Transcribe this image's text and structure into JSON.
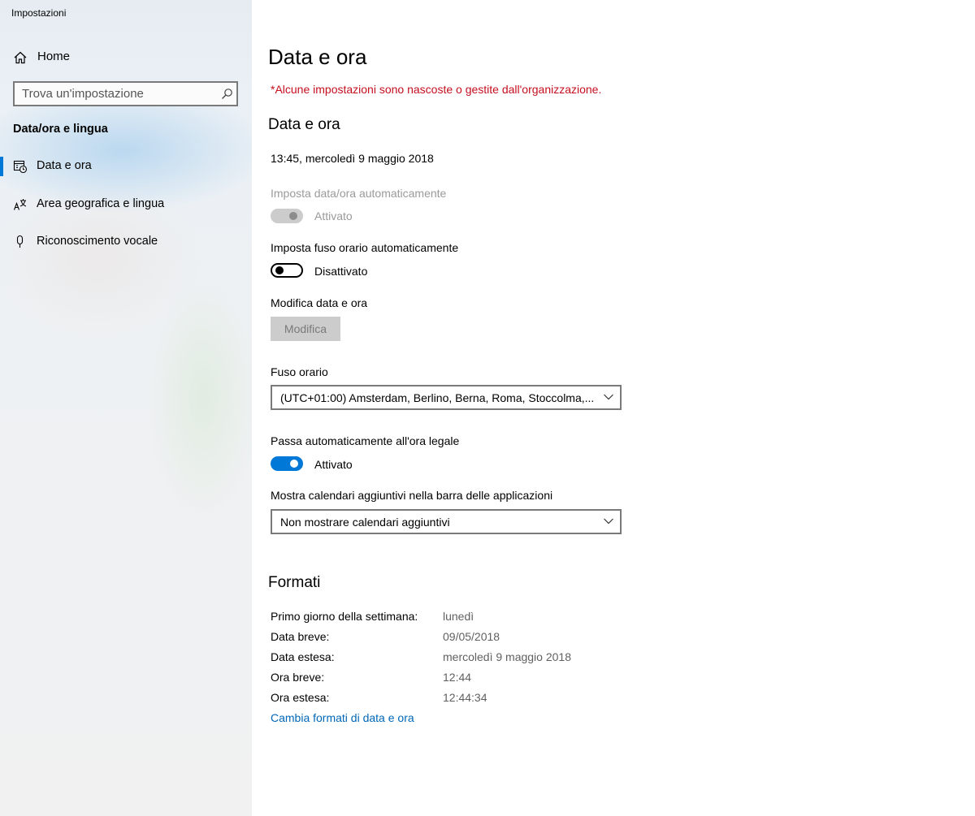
{
  "window": {
    "title": "Impostazioni"
  },
  "sidebar": {
    "home_label": "Home",
    "search_placeholder": "Trova un'impostazione",
    "section_header": "Data/ora e lingua",
    "items": [
      {
        "label": "Data e ora",
        "icon": "calendar-clock-icon",
        "selected": true
      },
      {
        "label": "Area geografica e lingua",
        "icon": "language-icon",
        "selected": false
      },
      {
        "label": "Riconoscimento vocale",
        "icon": "microphone-icon",
        "selected": false
      }
    ]
  },
  "main": {
    "title": "Data e ora",
    "warning": "*Alcune impostazioni sono nascoste o gestite dall'organizzazione.",
    "section_datetime": {
      "heading": "Data e ora",
      "current": "13:45, mercoledì 9 maggio 2018",
      "auto_time": {
        "label": "Imposta data/ora automaticamente",
        "state": "Attivato",
        "enabled": false,
        "on": true
      },
      "auto_timezone": {
        "label": "Imposta fuso orario automaticamente",
        "state": "Disattivato",
        "on": false
      },
      "change": {
        "label": "Modifica data e ora",
        "button": "Modifica"
      },
      "timezone": {
        "label": "Fuso orario",
        "value": "(UTC+01:00) Amsterdam, Berlino, Berna, Roma, Stoccolma,..."
      },
      "dst": {
        "label": "Passa automaticamente all'ora legale",
        "state": "Attivato",
        "on": true
      },
      "calendars": {
        "label": "Mostra calendari aggiuntivi nella barra delle applicazioni",
        "value": "Non mostrare calendari aggiuntivi"
      }
    },
    "formats": {
      "heading": "Formati",
      "rows": [
        {
          "label": "Primo giorno della settimana:",
          "value": "lunedì"
        },
        {
          "label": "Data breve:",
          "value": "09/05/2018"
        },
        {
          "label": "Data estesa:",
          "value": "mercoledì 9 maggio 2018"
        },
        {
          "label": "Ora breve:",
          "value": "12:44"
        },
        {
          "label": "Ora estesa:",
          "value": "12:44:34"
        }
      ],
      "link": "Cambia formati di data e ora"
    }
  },
  "colors": {
    "accent": "#0078d7",
    "warning": "#c50f1f",
    "link": "#0067b8"
  }
}
